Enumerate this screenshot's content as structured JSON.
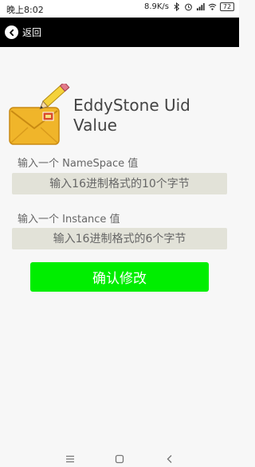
{
  "status_bar": {
    "time": "晚上8:02",
    "net_speed": "8.9K/s",
    "battery": "72"
  },
  "app_bar": {
    "back_label": "返回"
  },
  "main": {
    "title": "EddyStone Uid Value",
    "namespace": {
      "label": "输入一个 NameSpace 值",
      "placeholder": "输入16进制格式的10个字节",
      "value": ""
    },
    "instance": {
      "label": "输入一个 Instance 值",
      "placeholder": "输入16进制格式的6个字节",
      "value": ""
    },
    "confirm_label": "确认修改"
  },
  "colors": {
    "app_bar": "#000000",
    "input_bg": "#e2e2d8",
    "confirm": "#00ee00"
  },
  "icons": [
    "back-icon",
    "envelope-pencil-icon",
    "bluetooth-icon",
    "alarm-icon",
    "signal-icon",
    "wifi-icon",
    "battery-icon",
    "menu-icon",
    "home-icon",
    "back-nav-icon"
  ]
}
